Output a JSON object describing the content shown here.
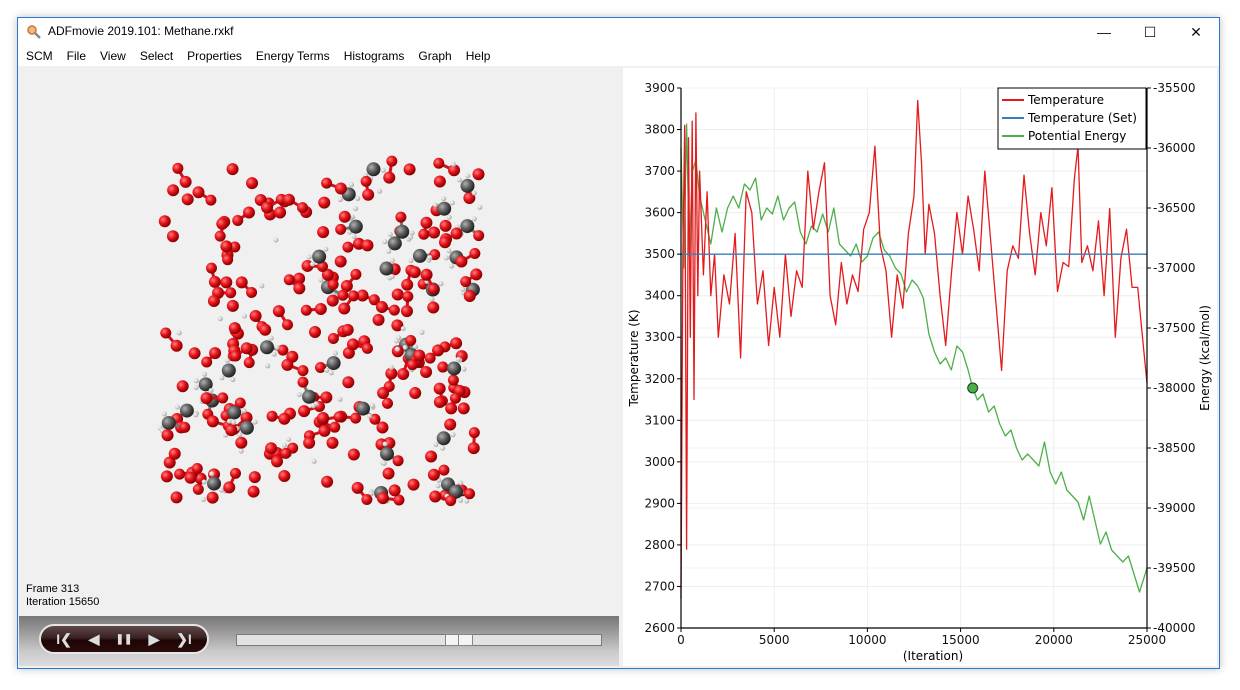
{
  "window": {
    "title": "ADFmovie 2019.101: Methane.rxkf",
    "icons": {
      "app": "magnifier-app-icon",
      "minimize": "minimize-icon",
      "maximize": "maximize-icon",
      "close": "close-icon"
    },
    "minimize_glyph": "—",
    "maximize_glyph": "☐",
    "close_glyph": "✕"
  },
  "menu": [
    "SCM",
    "File",
    "View",
    "Select",
    "Properties",
    "Energy Terms",
    "Histograms",
    "Graph",
    "Help"
  ],
  "viewer": {
    "frame_label": "Frame 313",
    "iteration_label": "Iteration 15650",
    "atom_colors": {
      "oxygen": "#e8141c",
      "carbon": "#5a5a5a",
      "hydrogen": "#f0f0f0"
    }
  },
  "player": {
    "buttons": [
      {
        "name": "first-frame-button",
        "icon": "skip-to-start-icon",
        "glyph": "I❮"
      },
      {
        "name": "previous-frame-button",
        "icon": "step-back-icon",
        "glyph": "◀"
      },
      {
        "name": "pause-button",
        "icon": "pause-icon",
        "glyph": "❚❚"
      },
      {
        "name": "next-frame-button",
        "icon": "step-forward-icon",
        "glyph": "▶"
      },
      {
        "name": "last-frame-button",
        "icon": "skip-to-end-icon",
        "glyph": "❯I"
      }
    ],
    "slider_position_fraction": 0.626
  },
  "chart_data": {
    "type": "line",
    "title": "",
    "xlabel": "(Iteration)",
    "ylabel": "Temperature (K)",
    "y2label": "Energy (kcal/mol)",
    "xlim": [
      0,
      25000
    ],
    "ylim": [
      2600,
      3900
    ],
    "y2lim": [
      -40000,
      -35500
    ],
    "xticks": [
      "0",
      "5000",
      "10000",
      "15000",
      "20000",
      "25000"
    ],
    "xtick_values": [
      0,
      5000,
      10000,
      15000,
      20000,
      25000
    ],
    "yticks": [
      "2600",
      "2700",
      "2800",
      "2900",
      "3000",
      "3100",
      "3200",
      "3300",
      "3400",
      "3500",
      "3600",
      "3700",
      "3800",
      "3900"
    ],
    "ytick_values": [
      2600,
      2700,
      2800,
      2900,
      3000,
      3100,
      3200,
      3300,
      3400,
      3500,
      3600,
      3700,
      3800,
      3900
    ],
    "y2ticks": [
      "-35500",
      "-36000",
      "-36500",
      "-37000",
      "-37500",
      "-38000",
      "-38500",
      "-39000",
      "-39500",
      "-40000"
    ],
    "y2tick_values": [
      -35500,
      -36000,
      -36500,
      -37000,
      -37500,
      -38000,
      -38500,
      -39000,
      -39500,
      -40000
    ],
    "grid": true,
    "legend_position": "top-right",
    "current_x": 15650,
    "current_energy": -38000,
    "series": [
      {
        "name": "Temperature",
        "axis": "left",
        "color": "#e41a1c",
        "x": [
          0,
          100,
          200,
          300,
          400,
          500,
          600,
          700,
          800,
          900,
          1000,
          1200,
          1400,
          1600,
          1800,
          2000,
          2300,
          2600,
          2900,
          3200,
          3500,
          3800,
          4100,
          4400,
          4700,
          5000,
          5300,
          5600,
          5900,
          6200,
          6500,
          6800,
          7100,
          7400,
          7700,
          8000,
          8300,
          8600,
          8900,
          9200,
          9500,
          9800,
          10100,
          10400,
          10700,
          11000,
          11300,
          11600,
          11900,
          12200,
          12500,
          12700,
          12900,
          13100,
          13300,
          13600,
          13900,
          14200,
          14500,
          14800,
          15100,
          15400,
          15700,
          16000,
          16300,
          16600,
          16900,
          17200,
          17500,
          17800,
          18100,
          18400,
          18700,
          19000,
          19300,
          19600,
          19900,
          20200,
          20500,
          20800,
          21100,
          21300,
          21500,
          21800,
          22100,
          22400,
          22700,
          23000,
          23300,
          23600,
          23900,
          24200,
          24500,
          24800,
          25000
        ],
        "values": [
          2670,
          3500,
          3810,
          2790,
          3780,
          3300,
          3820,
          3150,
          3840,
          3400,
          3700,
          3450,
          3650,
          3400,
          3500,
          3300,
          3450,
          3380,
          3550,
          3250,
          3650,
          3600,
          3380,
          3460,
          3280,
          3420,
          3300,
          3500,
          3350,
          3460,
          3420,
          3700,
          3560,
          3650,
          3720,
          3400,
          3330,
          3480,
          3380,
          3450,
          3410,
          3560,
          3600,
          3760,
          3520,
          3460,
          3300,
          3450,
          3370,
          3550,
          3640,
          3870,
          3720,
          3500,
          3620,
          3550,
          3400,
          3280,
          3450,
          3600,
          3500,
          3640,
          3560,
          3460,
          3700,
          3540,
          3380,
          3220,
          3460,
          3520,
          3490,
          3690,
          3550,
          3450,
          3600,
          3520,
          3660,
          3410,
          3480,
          3470,
          3680,
          3760,
          3480,
          3520,
          3460,
          3580,
          3400,
          3610,
          3300,
          3490,
          3560,
          3420,
          3420,
          3280,
          3190
        ]
      },
      {
        "name": "Temperature (Set)",
        "axis": "left",
        "color": "#377eb8",
        "x": [
          0,
          25000
        ],
        "values": [
          3500,
          3500
        ]
      },
      {
        "name": "Potential Energy",
        "axis": "right",
        "color": "#4daf4a",
        "x": [
          0,
          150,
          300,
          450,
          600,
          800,
          1000,
          1300,
          1600,
          1900,
          2200,
          2500,
          2800,
          3100,
          3400,
          3700,
          4000,
          4300,
          4600,
          4900,
          5200,
          5500,
          5800,
          6100,
          6400,
          6700,
          7000,
          7300,
          7600,
          7900,
          8200,
          8500,
          8800,
          9100,
          9400,
          9700,
          10000,
          10300,
          10600,
          10900,
          11200,
          11500,
          11800,
          12100,
          12400,
          12700,
          13000,
          13300,
          13600,
          13900,
          14200,
          14500,
          14800,
          15100,
          15400,
          15650,
          15900,
          16200,
          16500,
          16800,
          17100,
          17400,
          17700,
          18000,
          18300,
          18600,
          18900,
          19200,
          19500,
          19800,
          20100,
          20400,
          20700,
          21000,
          21300,
          21600,
          21900,
          22200,
          22500,
          22800,
          23100,
          23400,
          23700,
          24000,
          24300,
          24600,
          24800,
          25000
        ],
        "values": [
          -36000,
          -37000,
          -35800,
          -36900,
          -36200,
          -36100,
          -36400,
          -36600,
          -36800,
          -36500,
          -36700,
          -36500,
          -36400,
          -36500,
          -36300,
          -36350,
          -36250,
          -36600,
          -36500,
          -36550,
          -36400,
          -36600,
          -36500,
          -36450,
          -36700,
          -36800,
          -36650,
          -36700,
          -36550,
          -36700,
          -36500,
          -36800,
          -36850,
          -36900,
          -36800,
          -36950,
          -36900,
          -36750,
          -36700,
          -36850,
          -36900,
          -37000,
          -37050,
          -37200,
          -37100,
          -37150,
          -37250,
          -37550,
          -37700,
          -37800,
          -37750,
          -37850,
          -37650,
          -37700,
          -37850,
          -38000,
          -38100,
          -38050,
          -38200,
          -38150,
          -38300,
          -38400,
          -38350,
          -38500,
          -38600,
          -38550,
          -38600,
          -38650,
          -38450,
          -38700,
          -38800,
          -38700,
          -38850,
          -38900,
          -38950,
          -39100,
          -38900,
          -39100,
          -39300,
          -39200,
          -39350,
          -39400,
          -39450,
          -39400,
          -39550,
          -39700,
          -39600,
          -39500
        ]
      }
    ]
  }
}
